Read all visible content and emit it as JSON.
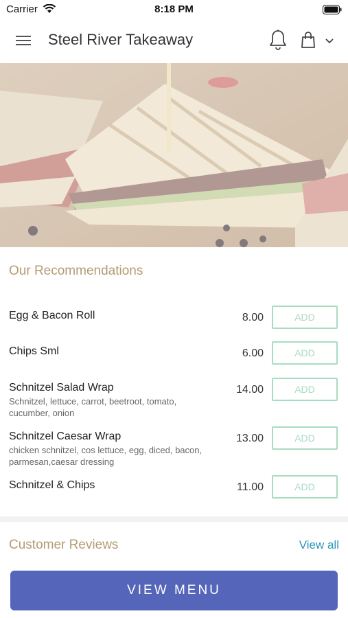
{
  "status_bar": {
    "carrier": "Carrier",
    "time": "8:18 PM"
  },
  "header": {
    "title": "Steel River Takeaway",
    "icons": [
      "menu-icon",
      "bell-icon",
      "shopping-bag-icon",
      "chevron-down-icon"
    ]
  },
  "recommendations": {
    "title": "Our Recommendations",
    "items": [
      {
        "name": "Egg & Bacon Roll",
        "description": "",
        "price": "8.00",
        "add": "ADD"
      },
      {
        "name": "Chips Sml",
        "description": "",
        "price": "6.00",
        "add": "ADD"
      },
      {
        "name": "Schnitzel Salad Wrap",
        "description": "Schnitzel, lettuce, carrot, beetroot, tomato, cucumber, onion",
        "price": "14.00",
        "add": "ADD"
      },
      {
        "name": "Schnitzel Caesar Wrap",
        "description": "chicken schnitzel, cos lettuce, egg, diced, bacon, parmesan,caesar dressing",
        "price": "13.00",
        "add": "ADD"
      },
      {
        "name": "Schnitzel & Chips",
        "description": "",
        "price": "11.00",
        "add": "ADD"
      }
    ]
  },
  "reviews": {
    "title": "Customer Reviews",
    "view_all": "View all"
  },
  "footer": {
    "view_menu": "VIEW MENU"
  },
  "colors": {
    "accent_gold": "#b39b72",
    "add_green": "#a8dcc1",
    "link_blue": "#2e95b8",
    "button_blue": "#5565b9"
  }
}
